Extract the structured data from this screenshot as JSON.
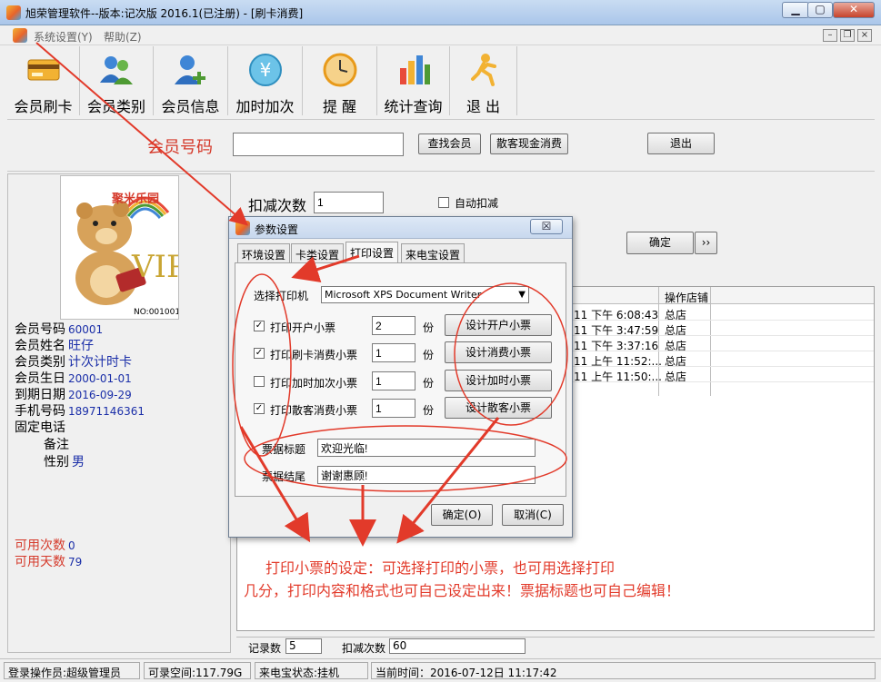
{
  "window": {
    "title": "旭荣管理软件--版本:记次版 2016.1(已注册) - [刷卡消费]"
  },
  "menu": {
    "items": [
      "系统设置(Y)",
      "帮助(Z)"
    ]
  },
  "toolbar": {
    "items": [
      "会员刷卡",
      "会员类别",
      "会员信息",
      "加时加次",
      "提 醒",
      "统计查询",
      "退 出"
    ]
  },
  "search": {
    "label": "会员号码",
    "value": "",
    "find_button": "查找会员",
    "cash_button": "散客现金消费",
    "exit_button": "退出"
  },
  "card_image": {
    "brand_text": "聚米乐园",
    "vip_text": "VIP",
    "card_no": "NO:001001"
  },
  "member": {
    "no_label": "会员号码",
    "no": "60001",
    "name_label": "会员姓名",
    "name": "旺仔",
    "type_label": "会员类别",
    "type": "计次计时卡",
    "birthday_label": "会员生日",
    "birthday": "2000-01-01",
    "expiry_label": "到期日期",
    "expiry": "2016-09-29",
    "mobile_label": "手机号码",
    "mobile": "18971146361",
    "phone_label": "固定电话",
    "phone": "",
    "remark_label": "备注",
    "remark": "",
    "gender_label": "性别",
    "gender": "男",
    "avail_count_label": "可用次数",
    "avail_count": "0",
    "avail_days_label": "可用天数",
    "avail_days": "79"
  },
  "deduct": {
    "label": "扣减次数",
    "value": "1",
    "auto_label": "自动扣减",
    "auto_checked": false,
    "confirm": "确定",
    "more": "››"
  },
  "grid": {
    "header_store": "操作店铺",
    "rows": [
      {
        "time": "11 下午 6:08:43",
        "store": "总店"
      },
      {
        "time": "11 下午 3:47:59",
        "store": "总店"
      },
      {
        "time": "11 下午 3:37:16",
        "store": "总店"
      },
      {
        "time": "11 上午 11:52:...",
        "store": "总店"
      },
      {
        "time": "11 上午 11:50:...",
        "store": "总店"
      }
    ]
  },
  "summary": {
    "record_label": "记录数",
    "record_value": "5",
    "deduct_label": "扣减次数",
    "deduct_value": "60"
  },
  "dialog": {
    "title": "参数设置",
    "close": "☒",
    "tabs": [
      "环境设置",
      "卡类设置",
      "打印设置",
      "来电宝设置"
    ],
    "active_tab": 2,
    "printer_label": "选择打印机",
    "printer_value": "Microsoft XPS Document Writer",
    "rows": [
      {
        "label": "打印开户小票",
        "checked": true,
        "count": "2",
        "unit": "份",
        "button": "设计开户小票"
      },
      {
        "label": "打印刷卡消费小票",
        "checked": true,
        "count": "1",
        "unit": "份",
        "button": "设计消费小票"
      },
      {
        "label": "打印加时加次小票",
        "checked": false,
        "count": "1",
        "unit": "份",
        "button": "设计加时小票"
      },
      {
        "label": "打印散客消费小票",
        "checked": true,
        "count": "1",
        "unit": "份",
        "button": "设计散客小票"
      }
    ],
    "ticket_title_label": "票据标题",
    "ticket_title_value": "欢迎光临!",
    "ticket_footer_label": "票据结尾",
    "ticket_footer_value": "谢谢惠顾!",
    "ok": "确定(O)",
    "cancel": "取消(C)"
  },
  "annotation": {
    "line1": "打印小票的设定：可选择打印的小票，也可用选择打印",
    "line2": "几分，打印内容和格式也可自己设定出来！票据标题也可自己编辑！"
  },
  "status": {
    "operator": "登录操作员:超级管理员",
    "space": "可录空间:117.79G",
    "phone_status": "来电宝状态:挂机",
    "time": "当前时间：2016-07-12日 11:17:42"
  },
  "colors": {
    "annotation": "#e23a2a",
    "value_text": "#1a2ea8"
  }
}
